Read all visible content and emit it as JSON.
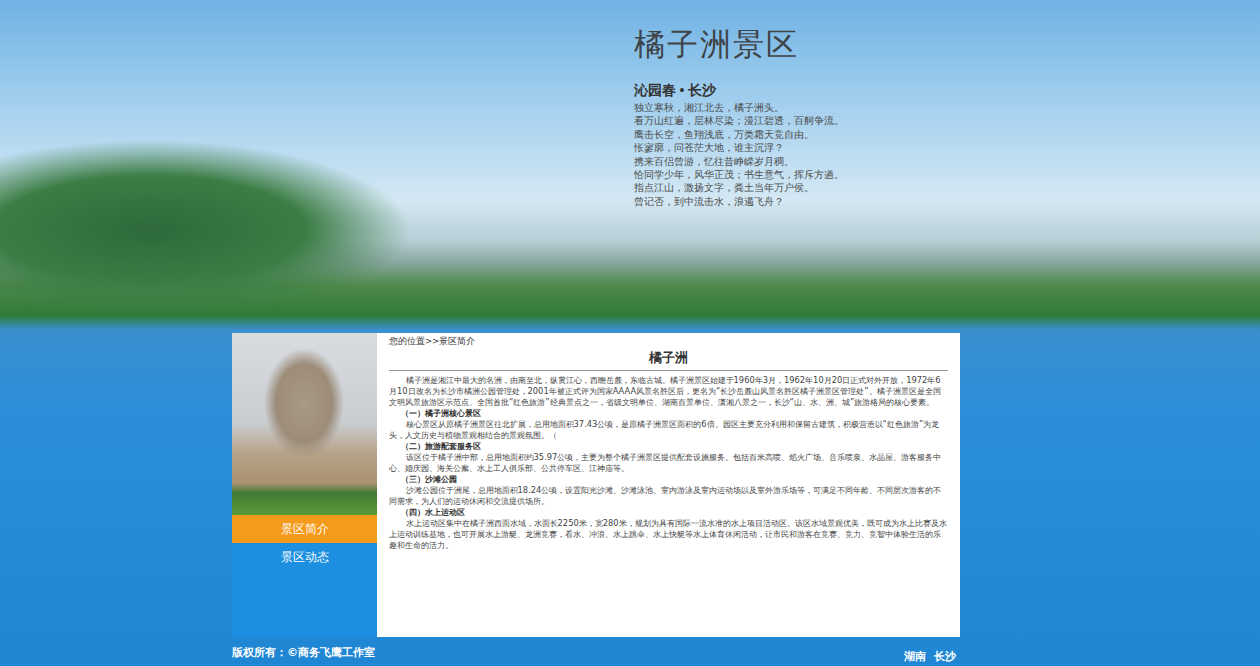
{
  "hero": {
    "title": "橘子洲景区",
    "poem_title": "沁园春 • 长沙",
    "poem_lines": [
      "独立寒秋，湘江北去，橘子洲头。",
      "看万山红遍，层林尽染；漫江碧透，百舸争流。",
      "鹰击长空，鱼翔浅底，万类霜天竞自由。",
      "怅寥廓，问苍茫大地，谁主沉浮？",
      "携来百侣曾游，忆往昔峥嵘岁月稠。",
      "恰同学少年，风华正茂；书生意气，挥斥方遒。",
      "指点江山，激扬文字，粪土当年万户侯。",
      "曾记否，到中流击水，浪遏飞舟？"
    ]
  },
  "sidebar": {
    "items": [
      {
        "label": "景区简介",
        "selected": true
      },
      {
        "label": "景区动态",
        "selected": false
      }
    ]
  },
  "content": {
    "breadcrumb": "您的位置>>景区简介",
    "title": "橘子洲",
    "blocks": [
      {
        "kind": "paragraph",
        "text": "橘子洲是湘江中最大的名洲，由南至北，纵贯江心，西瞻岳麓，东临古城。橘子洲景区始建于1960年3月，1962年10月20日正式对外开放，1972年6月10日改名为长沙市橘洲公园管理处，2001年被正式评为国家AAAA风景名胜区后，更名为“长沙岳麓山风景名胜区橘子洲景区管理处”。橘子洲景区是全国文明风景旅游区示范点、全国首批“红色旅游”经典景点之一，省级文明单位、湖南百景单位、潇湘八景之一，长沙“山、水、洲、城”旅游格局的核心要素。"
      },
      {
        "kind": "heading",
        "text": "（一）橘子洲核心景区"
      },
      {
        "kind": "paragraph",
        "text": "核心景区从原橘子洲景区往北扩展，总用地面积37.43公顷，是原橘子洲景区面积的6倍。园区主要充分利用和保留古建筑，积极营造以“红色旅游”为龙头，人文历史与植物景观相结合的景观氛围。（"
      },
      {
        "kind": "heading",
        "text": "（二）旅游配套服务区"
      },
      {
        "kind": "paragraph",
        "text": "该区位于橘子洲中部，总用地面积约35.97公顷，主要为整个橘子洲景区提供配套设施服务。包括百米高喷、焰火广场、音乐喷泉、水晶屋、游客服务中心、婚庆园、海关公廨、水上工人俱乐部、公共停车区、江神庙等。"
      },
      {
        "kind": "heading",
        "text": "（三）沙滩公园"
      },
      {
        "kind": "paragraph",
        "text": "沙滩公园位于洲尾，总用地面积18.24公顷，设置阳光沙滩、沙滩泳池、室内游泳及室内运动场以及室外游乐场等，可满足不同年龄、不同层次游客的不同需求，为人们的运动休闲和交流提供场所。"
      },
      {
        "kind": "heading",
        "text": "（四）水上运动区"
      },
      {
        "kind": "paragraph",
        "text": "水上运动区集中在橘子洲西面水域，水面长2250米，宽280米，规划为具有国际一流水准的水上项目活动区。该区水域景观优美，既可成为水上比赛及水上运动训练基地，也可开展水上游艇、龙洲竞赛，看水、冲浪、水上跳伞、水上快艇等水上体育休闲活动，让市民和游客在竞赛、竞力、竞智中体验生活的乐趣和生命的活力。"
      }
    ]
  },
  "footer": {
    "copyright": "版权所有：©商务飞鹰工作室",
    "location": "湖南  长沙"
  }
}
